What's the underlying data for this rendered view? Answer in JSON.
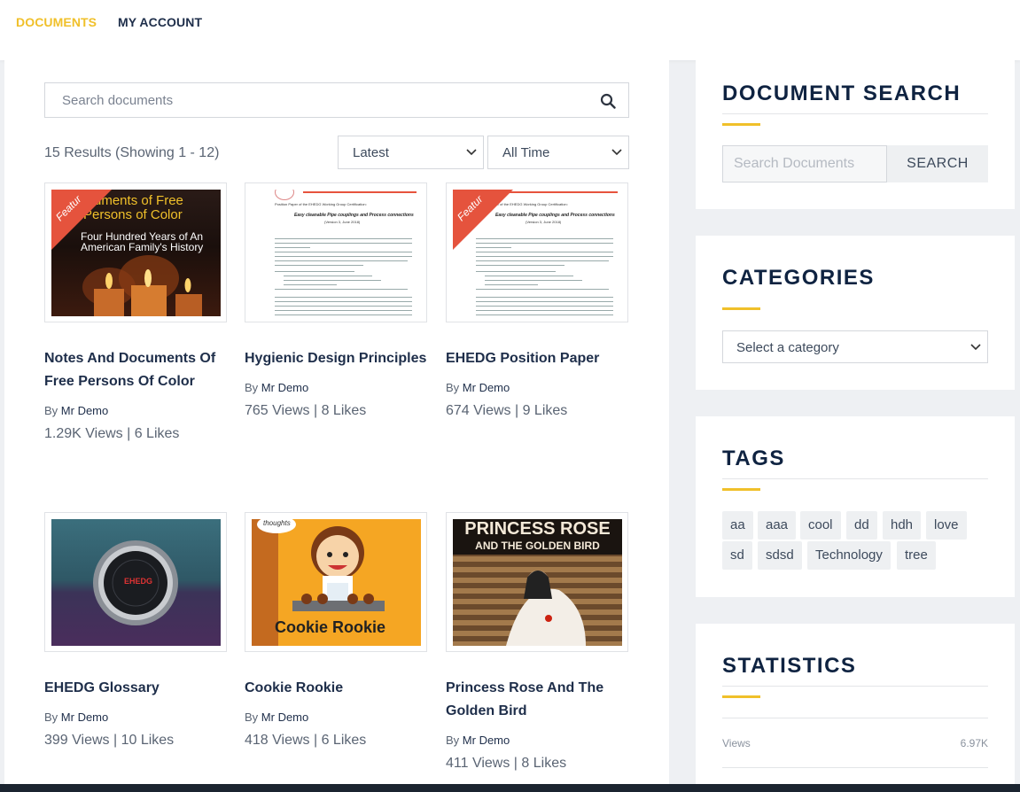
{
  "nav": {
    "documents": "DOCUMENTS",
    "my_account": "MY ACCOUNT"
  },
  "search": {
    "placeholder": "Search documents"
  },
  "results_text": "15 Results (Showing 1 - 12)",
  "filters": {
    "sort": "Latest",
    "time": "All Time"
  },
  "cards": [
    {
      "title": "Notes And Documents Of Free Persons Of Color",
      "by": "By",
      "author": "Mr Demo",
      "stats": "1.29K Views | 6 Likes",
      "featured": "Featur",
      "image": {
        "line1": "uments of Free",
        "line2": "Persons of Color",
        "line3": "Four Hundred Years of An",
        "line4": "American Family's History"
      }
    },
    {
      "title": "Hygienic Design Principles",
      "by": "By",
      "author": "Mr Demo",
      "stats": "765 Views | 8 Likes"
    },
    {
      "title": "EHEDG Position Paper",
      "by": "By",
      "author": "Mr Demo",
      "stats": "674 Views | 9 Likes",
      "featured": "Featur"
    },
    {
      "title": "EHEDG Glossary",
      "by": "By",
      "author": "Mr Demo",
      "stats": "399 Views | 10 Likes",
      "image": {
        "logo": "EHEDG"
      }
    },
    {
      "title": "Cookie Rookie",
      "by": "By",
      "author": "Mr Demo",
      "stats": "418 Views | 6 Likes",
      "image": {
        "tag": "thoughts",
        "title": "Cookie Rookie"
      }
    },
    {
      "title": "Princess Rose And The Golden Bird",
      "by": "By",
      "author": "Mr Demo",
      "stats": "411 Views | 8 Likes",
      "image": {
        "line1": "PRINCESS ROSE",
        "line2": "AND THE GOLDEN BIRD"
      }
    }
  ],
  "doc_page": {
    "header": "Position Paper of the EHEDG Working Group Certification:",
    "title": "Easy cleanable Pipe couplings and Process connections",
    "version": "(Version 3, June 2018)"
  },
  "sidebar": {
    "doc_search": {
      "title": "DOCUMENT SEARCH",
      "placeholder": "Search Documents",
      "button": "SEARCH"
    },
    "categories": {
      "title": "CATEGORIES",
      "select": "Select a category"
    },
    "tags": {
      "title": "TAGS",
      "items": [
        "aa",
        "aaa",
        "cool",
        "dd",
        "hdh",
        "love",
        "sd",
        "sdsd",
        "Technology",
        "tree"
      ]
    },
    "statistics": {
      "title": "STATISTICS",
      "rows": [
        {
          "label": "Views",
          "value": "6.97K"
        }
      ]
    }
  },
  "colors": {
    "accent": "#f0c02a",
    "heading": "#0f2341",
    "ribbon": "#e5533d"
  }
}
